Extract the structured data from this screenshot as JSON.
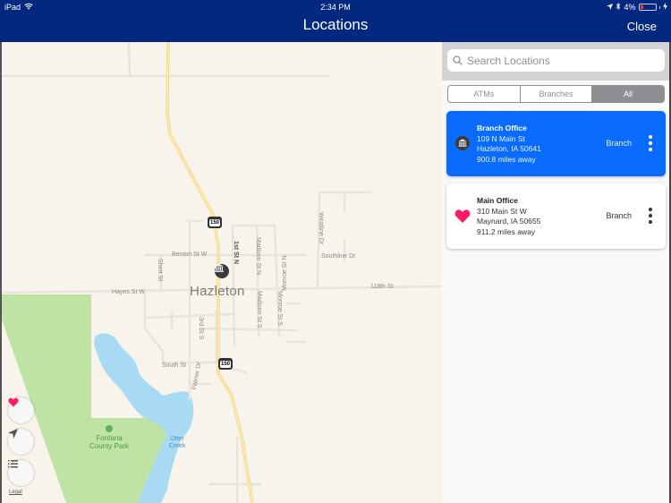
{
  "status_bar": {
    "device": "iPad",
    "time": "2:34 PM",
    "battery_percent": "4%",
    "battery_level": 0.04,
    "icons": [
      "wifi-icon",
      "location-arrow-icon",
      "bluetooth-icon",
      "battery-icon",
      "charging-icon"
    ]
  },
  "nav": {
    "title": "Locations",
    "close_label": "Close"
  },
  "colors": {
    "nav_background": "#02287f",
    "selected_card": "#0a6cff",
    "favorite": "#ff1a66",
    "park": "#bfe3a5",
    "water": "#a9daf3",
    "highway": "#f6d98a"
  },
  "map": {
    "city_label": "Hazleton",
    "park_label": "Fontana County Park",
    "water_label": "Otter Creek",
    "highway_number": "150",
    "street_labels": {
      "benton": "Benton St W",
      "hayes": "Hayes St W",
      "street_118": "118th St",
      "short": "Short St",
      "first": "1st St N",
      "madison_n": "Madison St N",
      "monroe_n": "Monroe St N",
      "madison_s": "Madison St S",
      "monroe_s": "Monroe St S",
      "third": "3rd St S",
      "south": "South St",
      "palmer": "Palmer Dr",
      "westline": "Westline Dr",
      "southline": "Southline Dr"
    },
    "legal_label": "Legal",
    "controls": [
      {
        "name": "favorites",
        "icon": "heart-icon"
      },
      {
        "name": "current-location",
        "icon": "location-arrow-icon"
      },
      {
        "name": "list",
        "icon": "list-icon"
      }
    ]
  },
  "panel": {
    "search_placeholder": "Search Locations",
    "search_value": "",
    "filters": [
      {
        "label": "ATMs",
        "active": false
      },
      {
        "label": "Branches",
        "active": false
      },
      {
        "label": "All",
        "active": true
      }
    ],
    "locations": [
      {
        "name": "Branch Office",
        "address1": "109 N Main St",
        "address2": "Hazleton, IA 50641",
        "distance": "900.8 miles away",
        "type": "Branch",
        "icon": "bank-icon",
        "selected": true
      },
      {
        "name": "Main Office",
        "address1": "310 Main St W",
        "address2": "Maynard, IA 50655",
        "distance": "911.2 miles away",
        "type": "Branch",
        "icon": "heart-icon",
        "selected": false
      }
    ]
  }
}
